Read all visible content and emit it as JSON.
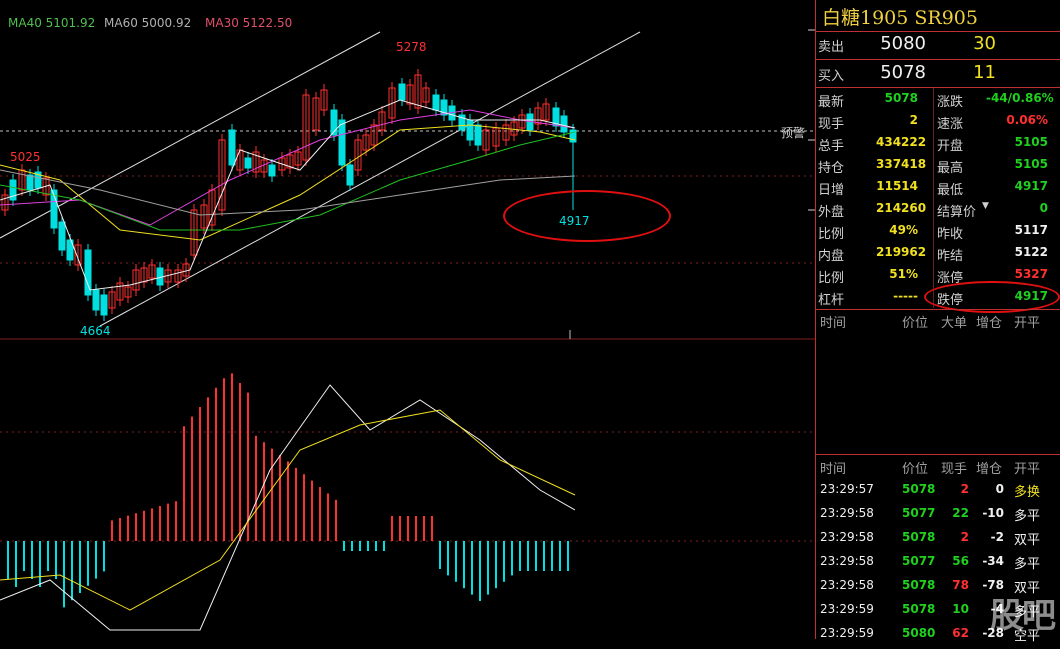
{
  "chart": {
    "ma_labels": {
      "ma40": "MA40 5101.92",
      "ma60": "MA60 5000.92",
      "ma30": "MA30 5122.50"
    },
    "price_labels": {
      "high": "5278",
      "left_high": "5025",
      "low": "4664",
      "last_low": "4917"
    },
    "alert_label": "预警",
    "colors": {
      "up": "#ff3030",
      "down": "#00e0e0",
      "ma5": "#f0f0f0",
      "ma10": "#f0e020",
      "ma20": "#e040e0",
      "ma40": "#20c020",
      "ma60": "#a0a0a0"
    }
  },
  "quote": {
    "title": "白糖1905  SR905",
    "sell": {
      "label": "卖出",
      "price": "5080",
      "vol": "30"
    },
    "buy": {
      "label": "买入",
      "price": "5078",
      "vol": "11"
    },
    "left": [
      {
        "label": "最新",
        "value": "5078",
        "color": "grn"
      },
      {
        "label": "现手",
        "value": "2",
        "color": "yel"
      },
      {
        "label": "总手",
        "value": "434222",
        "color": "yel"
      },
      {
        "label": "持仓",
        "value": "337418",
        "color": "yel"
      },
      {
        "label": "日增",
        "value": "11514",
        "color": "yel"
      },
      {
        "label": "外盘",
        "value": "214260",
        "color": "yel"
      },
      {
        "label": "比例",
        "value": "49%",
        "color": "yel"
      },
      {
        "label": "内盘",
        "value": "219962",
        "color": "yel"
      },
      {
        "label": "比例",
        "value": "51%",
        "color": "yel"
      },
      {
        "label": "杠杆",
        "value": "-----",
        "color": "yel"
      }
    ],
    "right": [
      {
        "label": "涨跌",
        "value": "-44/0.86%",
        "color": "grn"
      },
      {
        "label": "速涨",
        "value": "0.06%",
        "color": "red"
      },
      {
        "label": "开盘",
        "value": "5105",
        "color": "grn"
      },
      {
        "label": "最高",
        "value": "5105",
        "color": "grn"
      },
      {
        "label": "最低",
        "value": "4917",
        "color": "grn"
      },
      {
        "label": "结算价",
        "value": "0",
        "color": "grn"
      },
      {
        "label": "昨收",
        "value": "5117",
        "color": "wht"
      },
      {
        "label": "昨结",
        "value": "5122",
        "color": "wht"
      },
      {
        "label": "涨停",
        "value": "5327",
        "color": "red"
      },
      {
        "label": "跌停",
        "value": "4917",
        "color": "grn"
      }
    ]
  },
  "big_orders": {
    "headers": [
      "时间",
      "价位",
      "大单",
      "增仓",
      "开平"
    ]
  },
  "ticks": {
    "headers": [
      "时间",
      "价位",
      "现手",
      "增仓",
      "开平"
    ],
    "rows": [
      {
        "time": "23:29:57",
        "price": "5078",
        "qty": "2",
        "qty_color": "red",
        "oi": "0",
        "type": "多换",
        "type_color": "yel"
      },
      {
        "time": "23:29:58",
        "price": "5077",
        "qty": "22",
        "qty_color": "grn",
        "oi": "-10",
        "type": "多平",
        "type_color": "wht"
      },
      {
        "time": "23:29:58",
        "price": "5078",
        "qty": "2",
        "qty_color": "red",
        "oi": "-2",
        "type": "双平",
        "type_color": "wht"
      },
      {
        "time": "23:29:58",
        "price": "5077",
        "qty": "56",
        "qty_color": "grn",
        "oi": "-34",
        "type": "多平",
        "type_color": "wht"
      },
      {
        "time": "23:29:58",
        "price": "5078",
        "qty": "78",
        "qty_color": "red",
        "oi": "-78",
        "type": "双平",
        "type_color": "wht"
      },
      {
        "time": "23:29:59",
        "price": "5078",
        "qty": "10",
        "qty_color": "grn",
        "oi": "-4",
        "type": "多平",
        "type_color": "wht"
      },
      {
        "time": "23:29:59",
        "price": "5080",
        "qty": "62",
        "qty_color": "red",
        "oi": "-28",
        "type": "空平",
        "type_color": "wht"
      }
    ]
  },
  "watermark": "股吧"
}
